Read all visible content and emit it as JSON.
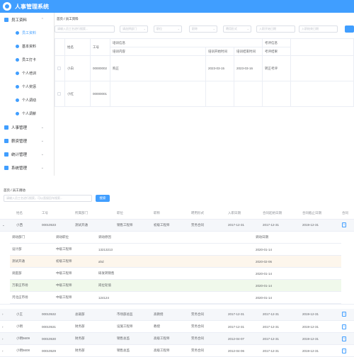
{
  "app": {
    "title": "人事管理系统"
  },
  "sidebar": {
    "groups": [
      {
        "label": "员工资料",
        "subs": [
          "员工资料",
          "基本资料",
          "员工打卡",
          "个人培训",
          "个人奖惩",
          "个人调动",
          "个人调薪"
        ]
      },
      {
        "label": "人事管理"
      },
      {
        "label": "薪资管理"
      },
      {
        "label": "统计管理"
      },
      {
        "label": "系统管理"
      }
    ]
  },
  "top": {
    "breadcrumb": [
      "首页",
      "员工资料"
    ],
    "search": {
      "placeholder": "请输入员工名进行搜索...",
      "dept": "请选择部门",
      "pos": "职位",
      "job": "职称",
      "type": "聘用形式",
      "date_start": "入职开始日期",
      "date_end": "入职结束日期"
    },
    "headers": {
      "name": "姓名",
      "workid": "工号",
      "train_group": "培训信息",
      "train_content": "培训内容",
      "train_start": "培训开始时间",
      "train_end": "培训结束时间",
      "exam_group": "考评信息",
      "exam_result": "考评结果"
    },
    "rows": [
      {
        "name": "小白",
        "workid": "00000002",
        "content": "购正",
        "start": "2023-03-15",
        "end": "2023-03-16",
        "result": "转正考评"
      },
      {
        "name": "小红",
        "workid": "00000001",
        "content": "",
        "start": "",
        "end": "",
        "result": ""
      }
    ]
  },
  "bottom": {
    "breadcrumb": [
      "首页",
      "员工调动"
    ],
    "search_placeholder": "请输入员工名进行搜索，可以直接回车搜索...",
    "search_btn": "搜索",
    "headers": [
      "姓名",
      "工号",
      "所属部门",
      "职位",
      "职称",
      "聘用形式",
      "入职日期",
      "合同起始日期",
      "合同截止日期",
      "合同"
    ],
    "expanded": {
      "name": "小西",
      "workid": "00010533",
      "dept": "测试开通",
      "pos": "销售工程师",
      "job": "初级工程师",
      "type": "劳务合同",
      "in": "2017-12-31",
      "cs": "2017-12-31",
      "ce": "2019-12-31",
      "ct": "1"
    },
    "inner_headers": [
      "调动部门",
      "调动职位",
      "调动原因",
      "调动日期"
    ],
    "inner_rows": [
      {
        "dept": "设计部",
        "pos": "中级工程师",
        "reason": "13213213",
        "date": "2020-01-14"
      },
      {
        "dept": "测试开通",
        "pos": "初级工程师",
        "reason": "ahd",
        "date": "2020-02-06"
      },
      {
        "dept": "调度部",
        "pos": "中级工程师",
        "reason": "研发转销售",
        "date": "2020-01-14"
      },
      {
        "dept": "万家庄市场",
        "pos": "中级工程师",
        "reason": "岗位轮值",
        "date": "2020-01-14"
      },
      {
        "dept": "河北庄市场",
        "pos": "中级工程师",
        "reason": "124124",
        "date": "2020-01-14"
      }
    ],
    "rows": [
      {
        "name": "小王",
        "workid": "00010532",
        "dept": "总裁部",
        "pos": "市场部总监",
        "job": "高教授",
        "type": "劳务合同",
        "in": "2017-12-31",
        "cs": "2017-12-31",
        "ce": "2019-12-31",
        "ct": "1"
      },
      {
        "name": "小明",
        "workid": "00010531",
        "dept": "财务部",
        "pos": "设施工程师",
        "job": "教授",
        "type": "劳务合同",
        "in": "2017-12-31",
        "cs": "2017-12-31",
        "ce": "2019-12-31",
        "ct": "1"
      },
      {
        "name": "小明5609",
        "workid": "00010530",
        "dept": "财务部",
        "pos": "销售总监",
        "job": "高级工程师",
        "type": "劳务合同",
        "in": "2012-04-07",
        "cs": "2017-12-31",
        "ce": "2019-12-31",
        "ct": "1"
      },
      {
        "name": "小明5608",
        "workid": "00010529",
        "dept": "财务部",
        "pos": "销售总监",
        "job": "高级工程师",
        "type": "劳务合同",
        "in": "2012-04-06",
        "cs": "2017-12-31",
        "ce": "2019-12-31",
        "ct": "1"
      }
    ]
  },
  "colors": {
    "accent": "#409eff"
  }
}
